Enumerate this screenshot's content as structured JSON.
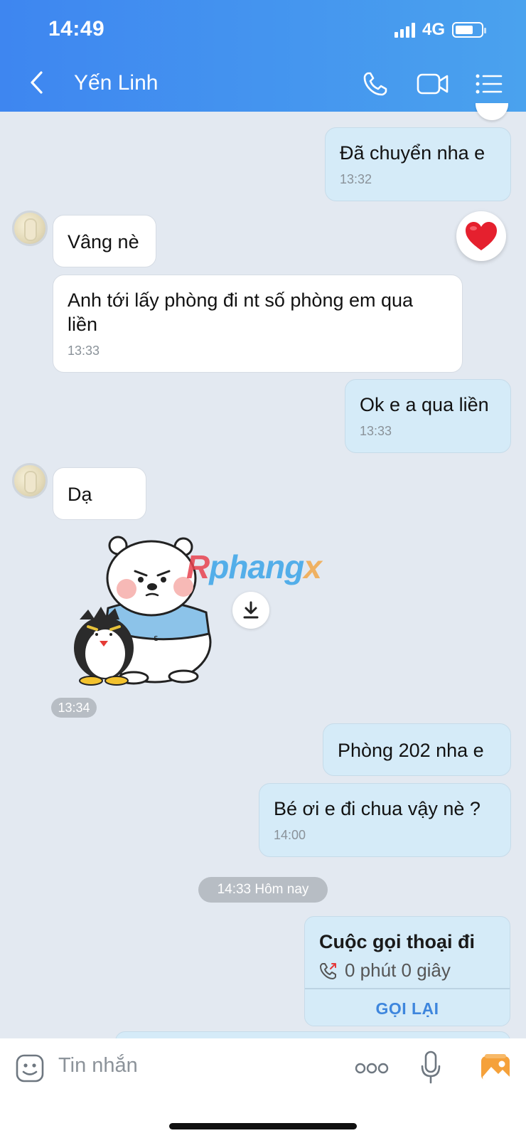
{
  "status_bar": {
    "time": "14:49",
    "network": "4G"
  },
  "header": {
    "contact_name": "Yến Linh",
    "icons": [
      "back-chevron-icon",
      "phone-icon",
      "video-camera-icon",
      "list-menu-icon"
    ]
  },
  "messages": {
    "m1": {
      "text": "Đã chuyển nha e",
      "time": "13:32"
    },
    "m2": {
      "text": "Vâng nè"
    },
    "reaction": "heart",
    "m3": {
      "text": "Anh tới lấy phòng đi nt số phòng em qua liền",
      "time": "13:33"
    },
    "m4": {
      "text": "Ok e a qua liền",
      "time": "13:33"
    },
    "m5": {
      "text": "Dạ"
    },
    "sticker": {
      "description": "polar-bear-and-penguin-sticker",
      "time": "13:34",
      "watermark_a": "R",
      "watermark_b": "phang",
      "watermark_c": "x"
    },
    "m6": {
      "text": "Phòng 202 nha e"
    },
    "m7": {
      "text": "Bé ơi e đi chua vậy nè ?",
      "time": "14:00"
    },
    "date_separator": "14:33 Hôm nay",
    "call": {
      "title": "Cuộc gọi thoại đi",
      "duration": "0 phút 0 giây",
      "action": "GỌI LẠI"
    }
  },
  "input_bar": {
    "placeholder": "Tin nhắn",
    "icons": [
      "sticker-face-icon",
      "more-dots-icon",
      "microphone-icon",
      "photo-gallery-icon"
    ]
  },
  "colors": {
    "header_start": "#3e86f0",
    "header_end": "#4aa2ee",
    "out_bubble": "#d5ebf8",
    "in_bubble": "#ffffff",
    "background": "#e3e9f1",
    "accent": "#3e86dd"
  }
}
